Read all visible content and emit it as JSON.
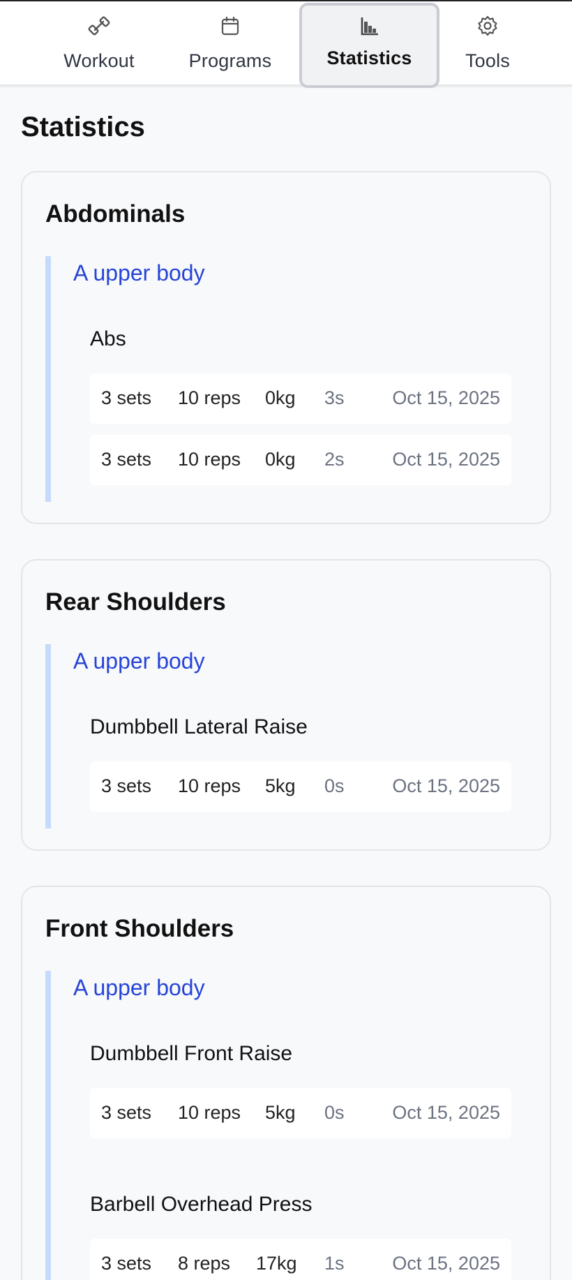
{
  "nav": {
    "tabs": [
      {
        "label": "Workout",
        "icon": "dumbbell-icon"
      },
      {
        "label": "Programs",
        "icon": "calendar-icon"
      },
      {
        "label": "Statistics",
        "icon": "bar-chart-icon",
        "active": true
      },
      {
        "label": "Tools",
        "icon": "gear-icon"
      }
    ]
  },
  "page": {
    "title": "Statistics"
  },
  "colors": {
    "accent": "#2644d8",
    "program_bar": "#c6dafc",
    "muted": "#6b7280"
  },
  "groups": [
    {
      "title": "Abdominals",
      "program": "A upper body",
      "exercises": [
        {
          "name": "Abs",
          "sets": [
            {
              "sets": "3 sets",
              "reps": "10 reps",
              "weight": "0kg",
              "duration": "3s",
              "date": "Oct 15, 2025"
            },
            {
              "sets": "3 sets",
              "reps": "10 reps",
              "weight": "0kg",
              "duration": "2s",
              "date": "Oct 15, 2025"
            }
          ]
        }
      ]
    },
    {
      "title": "Rear Shoulders",
      "program": "A upper body",
      "exercises": [
        {
          "name": "Dumbbell Lateral Raise",
          "sets": [
            {
              "sets": "3 sets",
              "reps": "10 reps",
              "weight": "5kg",
              "duration": "0s",
              "date": "Oct 15, 2025"
            }
          ]
        }
      ]
    },
    {
      "title": "Front Shoulders",
      "program": "A upper body",
      "exercises": [
        {
          "name": "Dumbbell Front Raise",
          "sets": [
            {
              "sets": "3 sets",
              "reps": "10 reps",
              "weight": "5kg",
              "duration": "0s",
              "date": "Oct 15, 2025"
            }
          ]
        },
        {
          "name": "Barbell Overhead Press",
          "sets": [
            {
              "sets": "3 sets",
              "reps": "8 reps",
              "weight": "17kg",
              "duration": "1s",
              "date": "Oct 15, 2025"
            }
          ]
        }
      ]
    }
  ]
}
